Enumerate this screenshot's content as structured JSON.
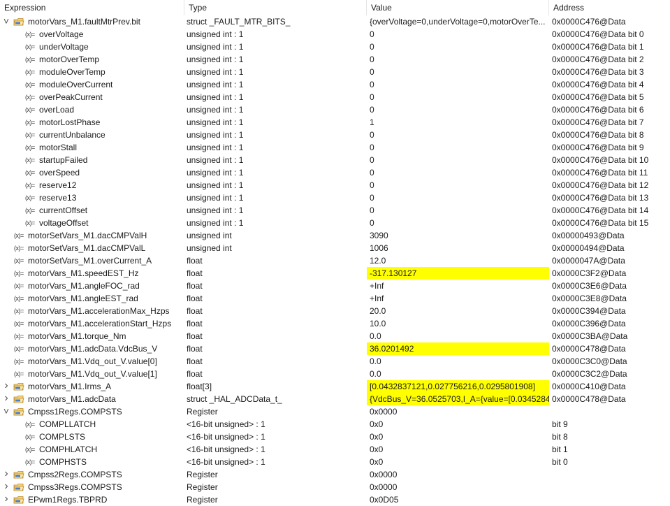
{
  "columns": {
    "expression": "Expression",
    "type": "Type",
    "value": "Value",
    "address": "Address"
  },
  "var_icon_text": "(x)=",
  "rows": [
    {
      "level": 0,
      "kind": "struct",
      "expanded": true,
      "name": "motorVars_M1.faultMtrPrev.bit",
      "type": "struct _FAULT_MTR_BITS_",
      "value": "{overVoltage=0,underVoltage=0,motorOverTe...",
      "address": "0x0000C476@Data",
      "highlight": false
    },
    {
      "level": 1,
      "kind": "var",
      "name": "overVoltage",
      "type": "unsigned int : 1",
      "value": "0",
      "address": "0x0000C476@Data bit 0",
      "highlight": false
    },
    {
      "level": 1,
      "kind": "var",
      "name": "underVoltage",
      "type": "unsigned int : 1",
      "value": "0",
      "address": "0x0000C476@Data bit 1",
      "highlight": false
    },
    {
      "level": 1,
      "kind": "var",
      "name": "motorOverTemp",
      "type": "unsigned int : 1",
      "value": "0",
      "address": "0x0000C476@Data bit 2",
      "highlight": false
    },
    {
      "level": 1,
      "kind": "var",
      "name": "moduleOverTemp",
      "type": "unsigned int : 1",
      "value": "0",
      "address": "0x0000C476@Data bit 3",
      "highlight": false
    },
    {
      "level": 1,
      "kind": "var",
      "name": "moduleOverCurrent",
      "type": "unsigned int : 1",
      "value": "0",
      "address": "0x0000C476@Data bit 4",
      "highlight": false
    },
    {
      "level": 1,
      "kind": "var",
      "name": "overPeakCurrent",
      "type": "unsigned int : 1",
      "value": "0",
      "address": "0x0000C476@Data bit 5",
      "highlight": false
    },
    {
      "level": 1,
      "kind": "var",
      "name": "overLoad",
      "type": "unsigned int : 1",
      "value": "0",
      "address": "0x0000C476@Data bit 6",
      "highlight": false
    },
    {
      "level": 1,
      "kind": "var",
      "name": "motorLostPhase",
      "type": "unsigned int : 1",
      "value": "1",
      "address": "0x0000C476@Data bit 7",
      "highlight": false
    },
    {
      "level": 1,
      "kind": "var",
      "name": "currentUnbalance",
      "type": "unsigned int : 1",
      "value": "0",
      "address": "0x0000C476@Data bit 8",
      "highlight": false
    },
    {
      "level": 1,
      "kind": "var",
      "name": "motorStall",
      "type": "unsigned int : 1",
      "value": "0",
      "address": "0x0000C476@Data bit 9",
      "highlight": false
    },
    {
      "level": 1,
      "kind": "var",
      "name": "startupFailed",
      "type": "unsigned int : 1",
      "value": "0",
      "address": "0x0000C476@Data bit 10",
      "highlight": false
    },
    {
      "level": 1,
      "kind": "var",
      "name": "overSpeed",
      "type": "unsigned int : 1",
      "value": "0",
      "address": "0x0000C476@Data bit 11",
      "highlight": false
    },
    {
      "level": 1,
      "kind": "var",
      "name": "reserve12",
      "type": "unsigned int : 1",
      "value": "0",
      "address": "0x0000C476@Data bit 12",
      "highlight": false
    },
    {
      "level": 1,
      "kind": "var",
      "name": "reserve13",
      "type": "unsigned int : 1",
      "value": "0",
      "address": "0x0000C476@Data bit 13",
      "highlight": false
    },
    {
      "level": 1,
      "kind": "var",
      "name": "currentOffset",
      "type": "unsigned int : 1",
      "value": "0",
      "address": "0x0000C476@Data bit 14",
      "highlight": false
    },
    {
      "level": 1,
      "kind": "var",
      "name": "voltageOffset",
      "type": "unsigned int : 1",
      "value": "0",
      "address": "0x0000C476@Data bit 15",
      "highlight": false
    },
    {
      "level": 0,
      "kind": "var",
      "name": "motorSetVars_M1.dacCMPValH",
      "type": "unsigned int",
      "value": "3090",
      "address": "0x00000493@Data",
      "highlight": false
    },
    {
      "level": 0,
      "kind": "var",
      "name": "motorSetVars_M1.dacCMPValL",
      "type": "unsigned int",
      "value": "1006",
      "address": "0x00000494@Data",
      "highlight": false
    },
    {
      "level": 0,
      "kind": "var",
      "name": "motorSetVars_M1.overCurrent_A",
      "type": "float",
      "value": "12.0",
      "address": "0x0000047A@Data",
      "highlight": false
    },
    {
      "level": 0,
      "kind": "var",
      "name": "motorVars_M1.speedEST_Hz",
      "type": "float",
      "value": "-317.130127",
      "address": "0x0000C3F2@Data",
      "highlight": true
    },
    {
      "level": 0,
      "kind": "var",
      "name": "motorVars_M1.angleFOC_rad",
      "type": "float",
      "value": "+Inf",
      "address": "0x0000C3E6@Data",
      "highlight": false
    },
    {
      "level": 0,
      "kind": "var",
      "name": "motorVars_M1.angleEST_rad",
      "type": "float",
      "value": "+Inf",
      "address": "0x0000C3E8@Data",
      "highlight": false
    },
    {
      "level": 0,
      "kind": "var",
      "name": "motorVars_M1.accelerationMax_Hzps",
      "type": "float",
      "value": "20.0",
      "address": "0x0000C394@Data",
      "highlight": false
    },
    {
      "level": 0,
      "kind": "var",
      "name": "motorVars_M1.accelerationStart_Hzps",
      "type": "float",
      "value": "10.0",
      "address": "0x0000C396@Data",
      "highlight": false
    },
    {
      "level": 0,
      "kind": "var",
      "name": "motorVars_M1.torque_Nm",
      "type": "float",
      "value": "0.0",
      "address": "0x0000C3BA@Data",
      "highlight": false
    },
    {
      "level": 0,
      "kind": "var",
      "name": "motorVars_M1.adcData.VdcBus_V",
      "type": "float",
      "value": "36.0201492",
      "address": "0x0000C478@Data",
      "highlight": true
    },
    {
      "level": 0,
      "kind": "var",
      "name": "motorVars_M1.Vdq_out_V.value[0]",
      "type": "float",
      "value": "0.0",
      "address": "0x0000C3C0@Data",
      "highlight": false
    },
    {
      "level": 0,
      "kind": "var",
      "name": "motorVars_M1.Vdq_out_V.value[1]",
      "type": "float",
      "value": "0.0",
      "address": "0x0000C3C2@Data",
      "highlight": false
    },
    {
      "level": 0,
      "kind": "struct",
      "expanded": false,
      "name": "motorVars_M1.Irms_A",
      "type": "float[3]",
      "value": "[0.0432837121,0.027756216,0.0295801908]",
      "address": "0x0000C410@Data",
      "highlight": true
    },
    {
      "level": 0,
      "kind": "struct",
      "expanded": false,
      "name": "motorVars_M1.adcData",
      "type": "struct _HAL_ADCData_t_",
      "value": "{VdcBus_V=36.0525703,I_A={value=[0.0345284...",
      "address": "0x0000C478@Data",
      "highlight": true
    },
    {
      "level": 0,
      "kind": "struct",
      "expanded": true,
      "name": "Cmpss1Regs.COMPSTS",
      "type": "Register",
      "value": "0x0000",
      "address": "",
      "highlight": false
    },
    {
      "level": 1,
      "kind": "var",
      "name": "COMPLLATCH",
      "type": "<16-bit unsigned> : 1",
      "value": "0x0",
      "address": "bit 9",
      "highlight": false
    },
    {
      "level": 1,
      "kind": "var",
      "name": "COMPLSTS",
      "type": "<16-bit unsigned> : 1",
      "value": "0x0",
      "address": "bit 8",
      "highlight": false
    },
    {
      "level": 1,
      "kind": "var",
      "name": "COMPHLATCH",
      "type": "<16-bit unsigned> : 1",
      "value": "0x0",
      "address": "bit 1",
      "highlight": false
    },
    {
      "level": 1,
      "kind": "var",
      "name": "COMPHSTS",
      "type": "<16-bit unsigned> : 1",
      "value": "0x0",
      "address": "bit 0",
      "highlight": false
    },
    {
      "level": 0,
      "kind": "struct",
      "expanded": false,
      "name": "Cmpss2Regs.COMPSTS",
      "type": "Register",
      "value": "0x0000",
      "address": "",
      "highlight": false
    },
    {
      "level": 0,
      "kind": "struct",
      "expanded": false,
      "name": "Cmpss3Regs.COMPSTS",
      "type": "Register",
      "value": "0x0000",
      "address": "",
      "highlight": false
    },
    {
      "level": 0,
      "kind": "struct",
      "expanded": false,
      "name": "EPwm1Regs.TBPRD",
      "type": "Register",
      "value": "0x0D05",
      "address": "",
      "highlight": false
    }
  ]
}
